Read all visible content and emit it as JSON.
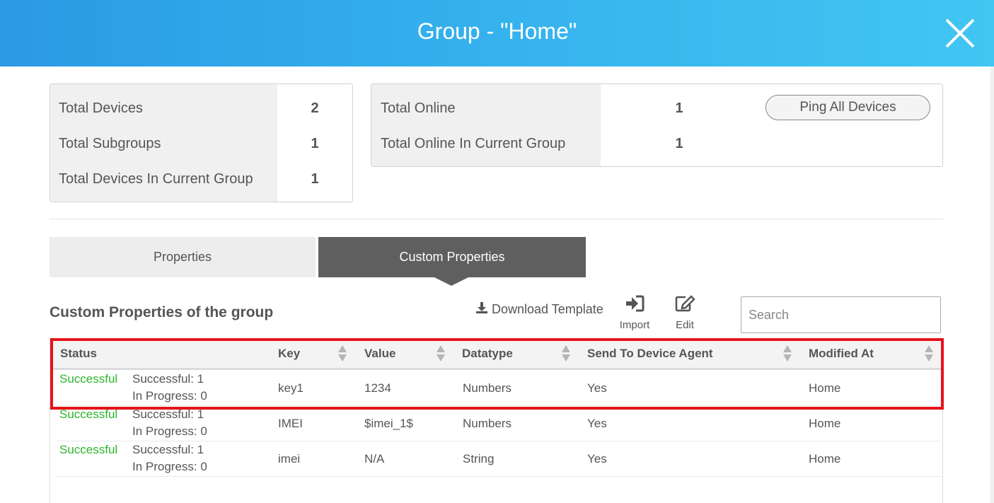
{
  "header": {
    "title": "Group - \"Home\"",
    "close_icon": "close-icon"
  },
  "summary_left": {
    "rows": [
      {
        "label": "Total Devices",
        "value": "2"
      },
      {
        "label": "Total Subgroups",
        "value": "1"
      },
      {
        "label": "Total Devices In Current Group",
        "value": "1"
      }
    ]
  },
  "summary_right": {
    "rows": [
      {
        "label": "Total Online",
        "value": "1"
      },
      {
        "label": "Total Online In Current Group",
        "value": "1"
      }
    ],
    "ping_button": "Ping All Devices"
  },
  "tabs": [
    {
      "label": "Properties",
      "active": false
    },
    {
      "label": "Custom Properties",
      "active": true
    }
  ],
  "section": {
    "title": "Custom Properties of the group",
    "download_template": "Download Template",
    "import_label": "Import",
    "edit_label": "Edit",
    "search_placeholder": "Search"
  },
  "table": {
    "columns": [
      "Status",
      "Key",
      "Value",
      "Datatype",
      "Send To Device Agent",
      "Modified At"
    ],
    "rows": [
      {
        "status": "Successful",
        "successful": "Successful: 1",
        "in_progress": "In Progress: 0",
        "key": "key1",
        "value": "1234",
        "datatype": "Numbers",
        "send": "Yes",
        "modified_at": "Home"
      },
      {
        "status": "Successful",
        "successful": "Successful: 1",
        "in_progress": "In Progress: 0",
        "key": "IMEI",
        "value": "$imei_1$",
        "datatype": "Numbers",
        "send": "Yes",
        "modified_at": "Home"
      },
      {
        "status": "Successful",
        "successful": "Successful: 1",
        "in_progress": "In Progress: 0",
        "key": "imei",
        "value": "N/A",
        "datatype": "String",
        "send": "Yes",
        "modified_at": "Home"
      }
    ]
  },
  "colors": {
    "header_gradient_start": "#2a9ae4",
    "header_gradient_end": "#41c6f2",
    "status_success": "#2cb52c",
    "active_tab": "#5f5f5f",
    "highlight": "#e5141c"
  }
}
